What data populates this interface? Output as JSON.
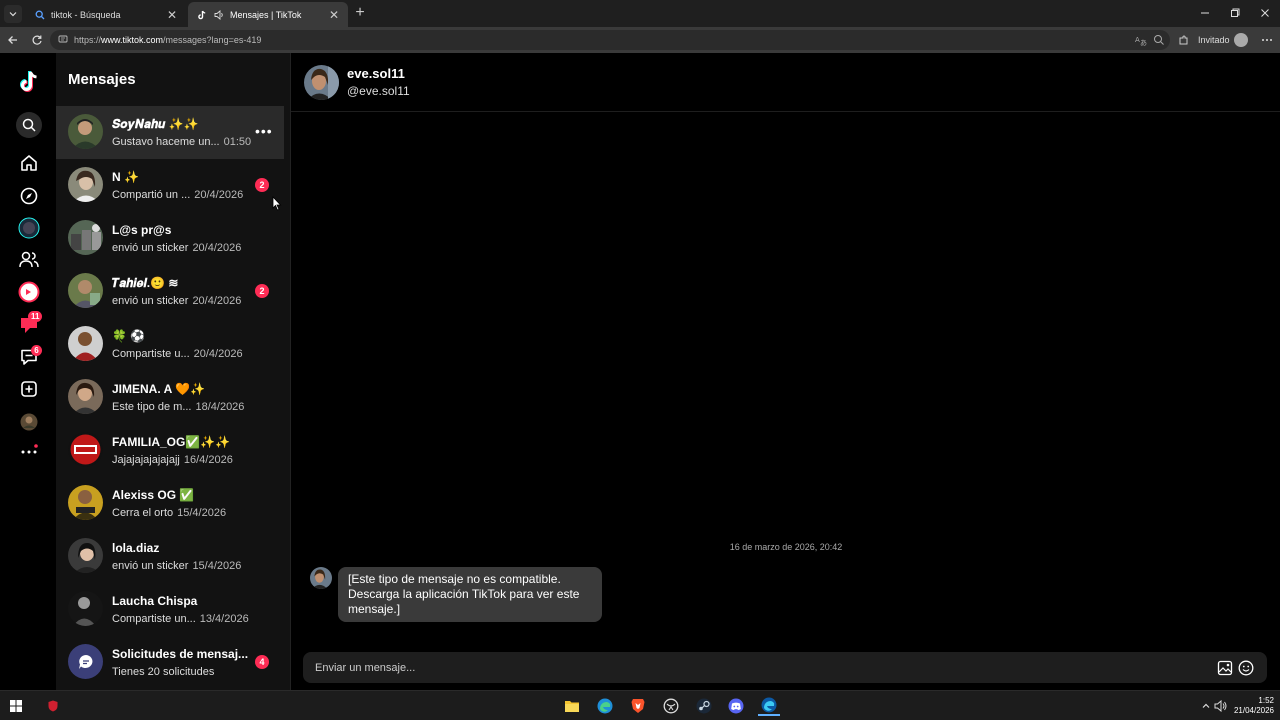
{
  "browser": {
    "tabs": [
      {
        "title": "tiktok - Búsqueda",
        "active": false
      },
      {
        "title": "Mensajes | TikTok",
        "active": true
      }
    ],
    "url": {
      "prefix": "https://",
      "domain": "www.tiktok.com",
      "path": "/messages?lang=es-419"
    },
    "profile_label": "Invitado"
  },
  "rail": {
    "badges": {
      "activity": "11",
      "messages": "6"
    }
  },
  "inbox": {
    "title": "Mensajes",
    "conversations": [
      {
        "name": "𝑺𝒐𝒚𝑵𝒂𝒉𝒖 ✨✨",
        "preview": "Gustavo haceme un...",
        "time": "01:50",
        "badge": "",
        "active": true
      },
      {
        "name": "N ✨",
        "preview": "Compartió un ...",
        "time": "20/4/2026",
        "badge": "2"
      },
      {
        "name": "L@s pr@s",
        "preview": "envió un sticker",
        "time": "20/4/2026",
        "badge": ""
      },
      {
        "name": "𝑻𝒂𝒉𝒊𝒆𝒍.🙂 ≋",
        "preview": "envió un sticker",
        "time": "20/4/2026",
        "badge": "2"
      },
      {
        "name": "🍀 ⚽",
        "preview": "Compartiste u...",
        "time": "20/4/2026",
        "badge": ""
      },
      {
        "name": "JIMENA. A 🧡✨",
        "preview": "Este tipo de m...",
        "time": "18/4/2026",
        "badge": ""
      },
      {
        "name": "FAMILIA_OG✅✨✨",
        "preview": "Jajajajajajajajj",
        "time": "16/4/2026",
        "badge": ""
      },
      {
        "name": "Alexiss OG ✅",
        "preview": "Cerra el orto",
        "time": "15/4/2026",
        "badge": ""
      },
      {
        "name": "lola.diaz",
        "preview": "envió un sticker",
        "time": "15/4/2026",
        "badge": ""
      },
      {
        "name": "Laucha Chispa",
        "preview": "Compartiste un...",
        "time": "13/4/2026",
        "badge": ""
      },
      {
        "name": "Solicitudes de mensaj...",
        "preview": "Tienes 20 solicitudes",
        "time": "",
        "badge": "4"
      }
    ]
  },
  "chat": {
    "display_name": "eve.sol11",
    "handle": "@eve.sol11",
    "timestamp": "16 de marzo de 2026, 20:42",
    "message": "[Este tipo de mensaje no es compatible. Descarga la aplicación TikTok para ver este mensaje.]",
    "composer_placeholder": "Enviar un mensaje..."
  },
  "taskbar": {
    "time": "1:52",
    "date": "21/04/2026"
  },
  "colors": {
    "accent": "#fe2c55",
    "background": "#000000",
    "list_bg": "#121212",
    "bubble": "#3a3a3a"
  }
}
